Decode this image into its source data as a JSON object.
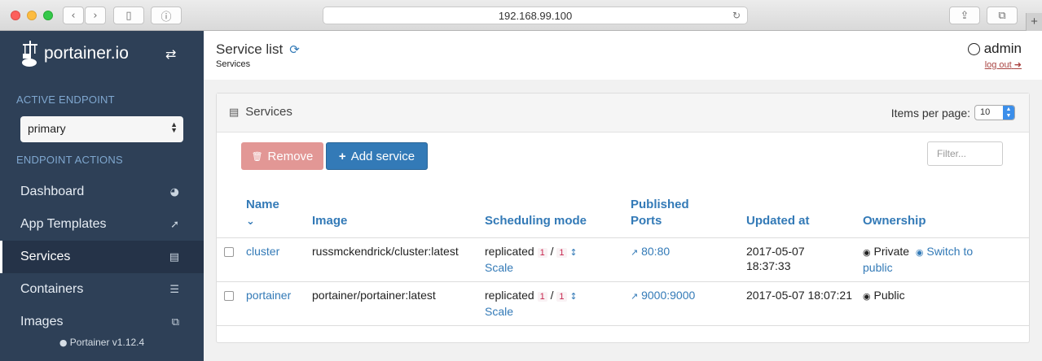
{
  "browser": {
    "url": "192.168.99.100"
  },
  "sidebar": {
    "logo_text": "portainer.io",
    "active_endpoint_heading": "ACTIVE ENDPOINT",
    "endpoint_selected": "primary",
    "endpoint_actions_heading": "ENDPOINT ACTIONS",
    "items": [
      {
        "label": "Dashboard",
        "icon": "tachometer-icon"
      },
      {
        "label": "App Templates",
        "icon": "rocket-icon"
      },
      {
        "label": "Services",
        "icon": "list-alt-icon",
        "active": true
      },
      {
        "label": "Containers",
        "icon": "server-icon"
      },
      {
        "label": "Images",
        "icon": "clone-icon"
      }
    ],
    "version": "Portainer v1.12.4"
  },
  "header": {
    "title": "Service list",
    "breadcrumb": "Services",
    "user": "admin",
    "logout": "log out"
  },
  "panel": {
    "title": "Services",
    "items_per_page_label": "Items per page:",
    "items_per_page_value": "10",
    "remove_label": "Remove",
    "add_label": "Add service",
    "filter_placeholder": "Filter..."
  },
  "table": {
    "columns": {
      "name": "Name",
      "image": "Image",
      "scheduling": "Scheduling mode",
      "ports_1": "Published",
      "ports_2": "Ports",
      "updated": "Updated at",
      "ownership": "Ownership"
    },
    "rows": [
      {
        "name": "cluster",
        "image": "russmckendrick/cluster:latest",
        "mode": "replicated",
        "running": "1",
        "desired": "1",
        "scale": "Scale",
        "port": "80:80",
        "updated_1": "2017-05-07",
        "updated_2": "18:37:33",
        "ownership": "Private",
        "switch": "Switch to",
        "switch_2": "public"
      },
      {
        "name": "portainer",
        "image": "portainer/portainer:latest",
        "mode": "replicated",
        "running": "1",
        "desired": "1",
        "scale": "Scale",
        "port": "9000:9000",
        "updated": "2017-05-07 18:07:21",
        "ownership": "Public"
      }
    ]
  }
}
